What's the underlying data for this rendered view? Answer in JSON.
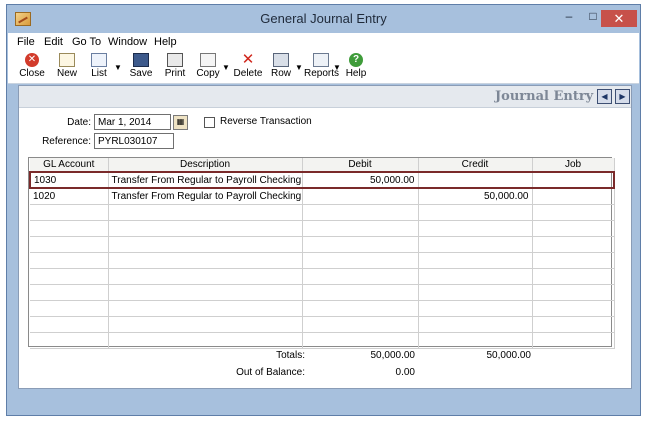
{
  "window": {
    "title": "General Journal Entry",
    "minimize_glyph": "–",
    "maximize_glyph": "□",
    "close_glyph": "✕"
  },
  "menu": {
    "items": [
      "File",
      "Edit",
      "Go To",
      "Window",
      "Help"
    ]
  },
  "toolbar": {
    "close": "Close",
    "new": "New",
    "list": "List",
    "save": "Save",
    "print": "Print",
    "copy": "Copy",
    "delete": "Delete",
    "row": "Row",
    "reports": "Reports",
    "help": "Help"
  },
  "panel": {
    "title": "Journal Entry",
    "prev_glyph": "◀",
    "next_glyph": "▶"
  },
  "form": {
    "date_label": "Date:",
    "date_value": "Mar 1, 2014",
    "reference_label": "Reference:",
    "reference_value": "PYRL030107",
    "reverse_label": "Reverse Transaction",
    "reverse_checked": false
  },
  "grid": {
    "columns": [
      "GL Account",
      "Description",
      "Debit",
      "Credit",
      "Job"
    ],
    "rows": [
      {
        "account": "1030",
        "description": "Transfer From Regular to Payroll Checking",
        "debit": "50,000.00",
        "credit": "",
        "job": ""
      },
      {
        "account": "1020",
        "description": "Transfer From Regular to Payroll Checking",
        "debit": "",
        "credit": "50,000.00",
        "job": ""
      }
    ],
    "empty_rows": 9
  },
  "totals": {
    "totals_label": "Totals:",
    "total_debit": "50,000.00",
    "total_credit": "50,000.00",
    "out_of_balance_label": "Out of Balance:",
    "out_of_balance_value": "0.00"
  },
  "colors": {
    "chrome": "#a7c0dd",
    "selected_row_border": "#7a2a2a",
    "close_button": "#c7514a"
  }
}
